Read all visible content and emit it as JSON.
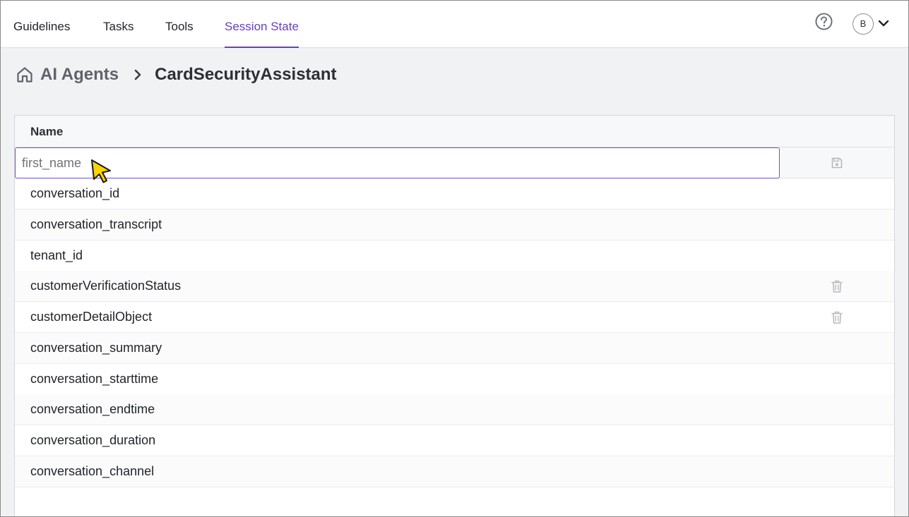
{
  "nav": {
    "tabs": [
      {
        "label": "Guidelines"
      },
      {
        "label": "Tasks"
      },
      {
        "label": "Tools"
      },
      {
        "label": "Session State",
        "active": true
      }
    ],
    "avatar_initial": "B"
  },
  "breadcrumb": {
    "parent": "AI Agents",
    "current": "CardSecurityAssistant"
  },
  "table": {
    "header": "Name",
    "new_entry_value": "first_name",
    "rows": [
      {
        "name": "conversation_id",
        "deletable": false
      },
      {
        "name": "conversation_transcript",
        "deletable": false
      },
      {
        "name": "tenant_id",
        "deletable": false
      },
      {
        "name": "customerVerificationStatus",
        "deletable": true
      },
      {
        "name": "customerDetailObject",
        "deletable": true
      },
      {
        "name": "conversation_summary",
        "deletable": false
      },
      {
        "name": "conversation_starttime",
        "deletable": false
      },
      {
        "name": "conversation_endtime",
        "deletable": false
      },
      {
        "name": "conversation_duration",
        "deletable": false
      },
      {
        "name": "conversation_channel",
        "deletable": false
      }
    ]
  },
  "colors": {
    "accent": "#6b3fb8",
    "text": "#1f2328",
    "muted_icon": "#b8babe"
  }
}
